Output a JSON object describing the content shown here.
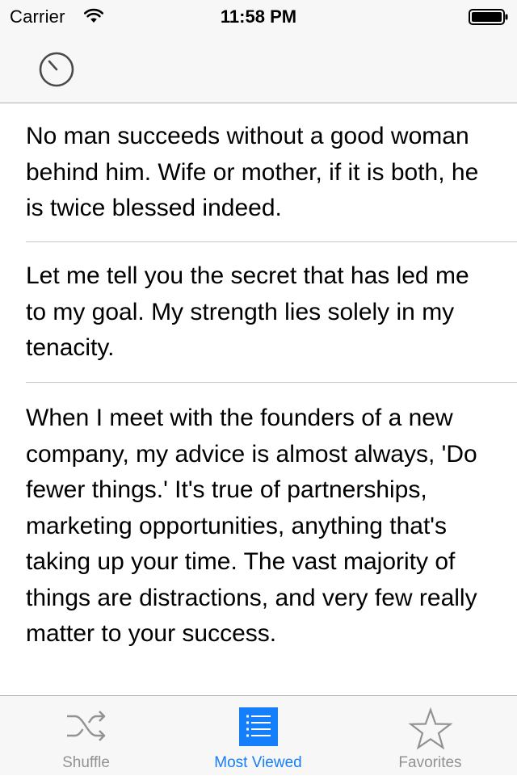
{
  "status_bar": {
    "carrier": "Carrier",
    "time": "11:58 PM",
    "wifi_icon": "wifi-icon",
    "battery_icon": "battery-icon"
  },
  "nav_bar": {
    "left_button_icon": "timer-icon"
  },
  "quotes": [
    {
      "text": "No man succeeds without a good woman behind him. Wife or mother, if it is both, he is twice blessed indeed."
    },
    {
      "text": "Let me tell you the secret that has led me to my goal. My strength lies solely in my tenacity."
    },
    {
      "text": "When I meet with the founders of a new company, my advice is almost always, 'Do fewer things.' It's true of partnerships, marketing opportunities, anything that's taking up your time. The vast majority of things are distractions, and very few really matter to your success."
    }
  ],
  "tab_bar": {
    "tabs": [
      {
        "label": "Shuffle",
        "icon": "shuffle-icon",
        "selected": false
      },
      {
        "label": "Most Viewed",
        "icon": "list-icon",
        "selected": true
      },
      {
        "label": "Favorites",
        "icon": "star-icon",
        "selected": false
      }
    ]
  },
  "colors": {
    "tint": "#157efb",
    "inactive": "#929292",
    "bar_background": "#f7f7f7"
  }
}
